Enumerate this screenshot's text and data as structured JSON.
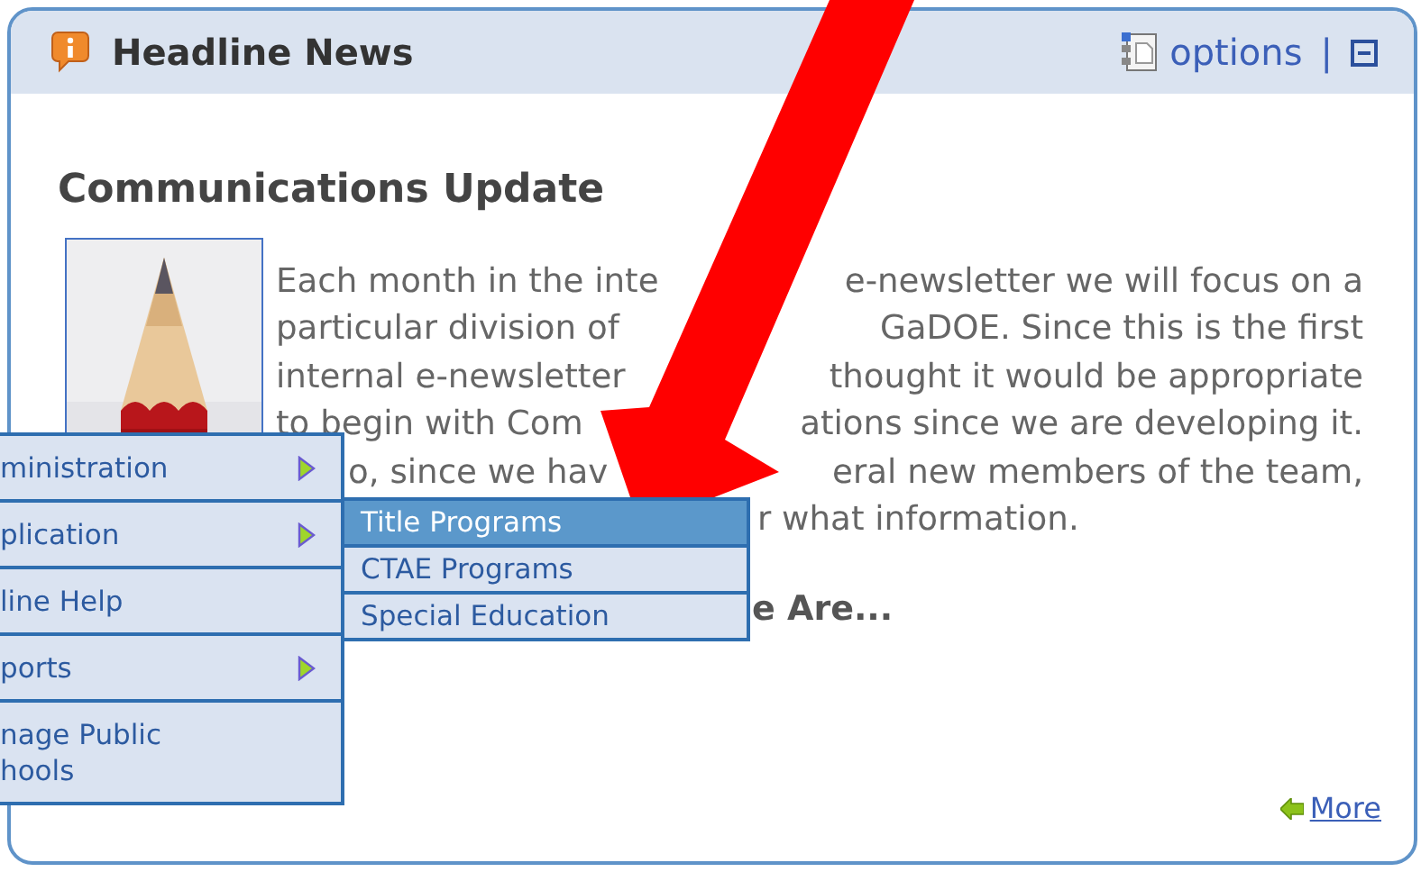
{
  "panel": {
    "title": "Headline News",
    "options_label": "options",
    "separator": "|"
  },
  "article": {
    "heading": "Communications Update",
    "lines": [
      {
        "left": "Each month in the inte",
        "right": "e-newsletter we will focus on a"
      },
      {
        "left": "particular division of",
        "right": "GaDOE. Since this is the first"
      },
      {
        "left": "internal e-newsletter",
        "right": "thought it would be appropriate"
      },
      {
        "left": "to begin with Com",
        "right": "ations since we are developing it."
      },
      {
        "left": "o, since we hav",
        "right": "eral new members of the team,"
      },
      {
        "right": "r what information."
      }
    ],
    "subheading": "e Are...",
    "more_label": "More"
  },
  "menu": {
    "items": [
      {
        "label": "ministration",
        "has_submenu": true
      },
      {
        "label": "plication",
        "has_submenu": true
      },
      {
        "label": "line Help",
        "has_submenu": false
      },
      {
        "label": "ports",
        "has_submenu": true
      },
      {
        "label": "nage Public\nhools",
        "has_submenu": false
      }
    ],
    "submenu": [
      {
        "label": "Title Programs",
        "selected": true
      },
      {
        "label": "CTAE Programs",
        "selected": false
      },
      {
        "label": "Special Education",
        "selected": false
      }
    ]
  }
}
